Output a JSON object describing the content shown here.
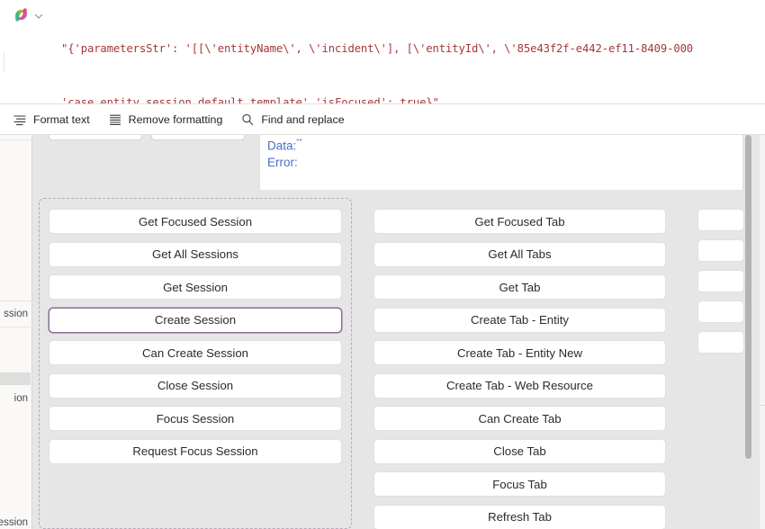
{
  "compose": {
    "icon": "copilot-icon",
    "expand_icon": "chevron-down-icon",
    "code_line_1": "\"{'parametersStr': '[[\\'entityName\\', \\'incident\\'], [\\'entityId\\', \\'85e43f2f-e442-ef11-8409-000",
    "code_line_2": "'case_entity_session_default_template','isFocused': true}\""
  },
  "format_toolbar": {
    "items": [
      {
        "label": "Format text",
        "icon": "format-text-icon"
      },
      {
        "label": "Remove formatting",
        "icon": "remove-formatting-icon"
      },
      {
        "label": "Find and replace",
        "icon": "search-icon"
      }
    ]
  },
  "output_panel": {
    "data_label": "Data:",
    "data_value": "\"\"",
    "error_label": "Error:",
    "error_value": ""
  },
  "left_pane": {
    "fragments": [
      {
        "text": "ssion"
      },
      {
        "text": ""
      },
      {
        "text": "ion"
      },
      {
        "text": "ession"
      }
    ]
  },
  "sessions_group": {
    "buttons": [
      {
        "label": "Get Focused Session",
        "selected": false
      },
      {
        "label": "Get All Sessions",
        "selected": false
      },
      {
        "label": "Get Session",
        "selected": false
      },
      {
        "label": "Create Session",
        "selected": true
      },
      {
        "label": "Can Create Session",
        "selected": false
      },
      {
        "label": "Close Session",
        "selected": false
      },
      {
        "label": "Focus Session",
        "selected": false
      },
      {
        "label": "Request Focus Session",
        "selected": false
      }
    ]
  },
  "tabs_group": {
    "buttons": [
      {
        "label": "Get Focused Tab"
      },
      {
        "label": "Get All Tabs"
      },
      {
        "label": "Get Tab"
      },
      {
        "label": "Create Tab - Entity"
      },
      {
        "label": "Create Tab - Entity New"
      },
      {
        "label": "Create Tab - Web Resource"
      },
      {
        "label": "Can Create Tab"
      },
      {
        "label": "Close Tab"
      },
      {
        "label": "Focus Tab"
      },
      {
        "label": "Refresh Tab"
      }
    ]
  },
  "mini_group": {
    "buttons": [
      {
        "label": ""
      },
      {
        "label": ""
      },
      {
        "label": ""
      },
      {
        "label": ""
      },
      {
        "label": ""
      }
    ]
  },
  "colors": {
    "code_text": "#a4373a",
    "output_text": "#4a6fc0",
    "selection_border": "#8d6c95",
    "group_dash": "#b9a9bd",
    "canvas_bg": "#e6e6e6"
  }
}
